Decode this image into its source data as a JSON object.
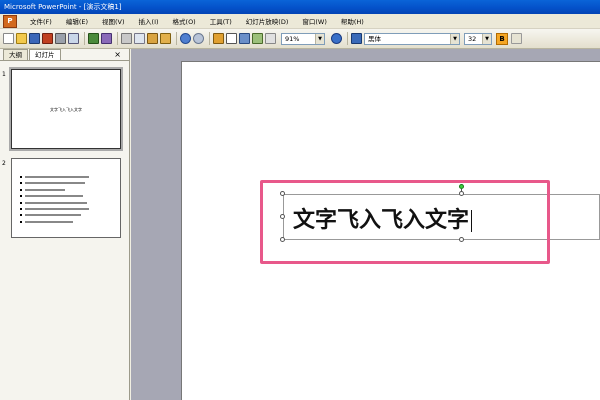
{
  "window": {
    "title": "Microsoft PowerPoint - [演示文稿1]"
  },
  "menu": {
    "items": [
      {
        "label": "文件(F)"
      },
      {
        "label": "编辑(E)"
      },
      {
        "label": "视图(V)"
      },
      {
        "label": "插入(I)"
      },
      {
        "label": "格式(O)"
      },
      {
        "label": "工具(T)"
      },
      {
        "label": "幻灯片放映(D)"
      },
      {
        "label": "窗口(W)"
      },
      {
        "label": "帮助(H)"
      }
    ]
  },
  "toolbar": {
    "zoom": "91%",
    "font_name": "黑体",
    "font_size": "32",
    "bold_label": "B"
  },
  "left_pane": {
    "tabs": [
      {
        "label": "大纲"
      },
      {
        "label": "幻灯片"
      }
    ],
    "close_glyph": "×",
    "slides": [
      {
        "number": "1",
        "thumb_text": "文字飞入飞入文字"
      },
      {
        "number": "2"
      }
    ]
  },
  "slide": {
    "text": "文字飞入飞入文字"
  },
  "colors": {
    "highlight": "#e8588a",
    "titlebar": "#0450c8"
  }
}
